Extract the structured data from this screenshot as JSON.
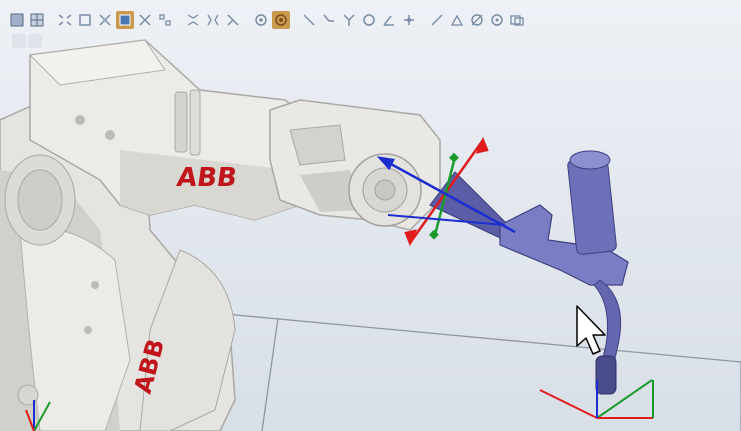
{
  "viewport": {
    "brand_text": "ABB",
    "colors": {
      "background_top": "#eef1f6",
      "background_bottom": "#d9dfe7",
      "robot_body": "#e8e6e2",
      "robot_shadow": "#a9a8a4",
      "brand_red": "#c0161b",
      "tool": "#7b7dc4",
      "tool_dark": "#4a4c8c",
      "axis_x": "#e01c1c",
      "axis_y": "#1a9a2a",
      "axis_z": "#1b2fd0",
      "floor_line": "#8e96a6"
    }
  },
  "toolbar": {
    "groups": [
      [
        "select-all-icon",
        "snap-grid-icon"
      ],
      [
        "selection-level-curve-icon",
        "selection-level-surface-icon",
        "selection-level-body-icon",
        "selection-level-part-icon",
        "selection-level-mechanism-icon",
        "selection-level-group-icon"
      ],
      [
        "snap-object-icon",
        "snap-center-icon",
        "snap-edge-icon",
        "snap-end-icon"
      ],
      [
        "measure-point-to-point-icon",
        "measure-angle-icon"
      ],
      [
        "frame-line-icon",
        "frame-polyline-icon",
        "frame-y-icon",
        "frame-circle-icon",
        "frame-angle-icon",
        "frame-arc-icon"
      ],
      [
        "freehand-move-icon",
        "freehand-rotate-icon",
        "freehand-jog-icon",
        "freehand-reorient-icon",
        "freehand-linear-icon"
      ]
    ],
    "active": [
      "selection-level-part-icon",
      "snap-center-icon"
    ]
  }
}
